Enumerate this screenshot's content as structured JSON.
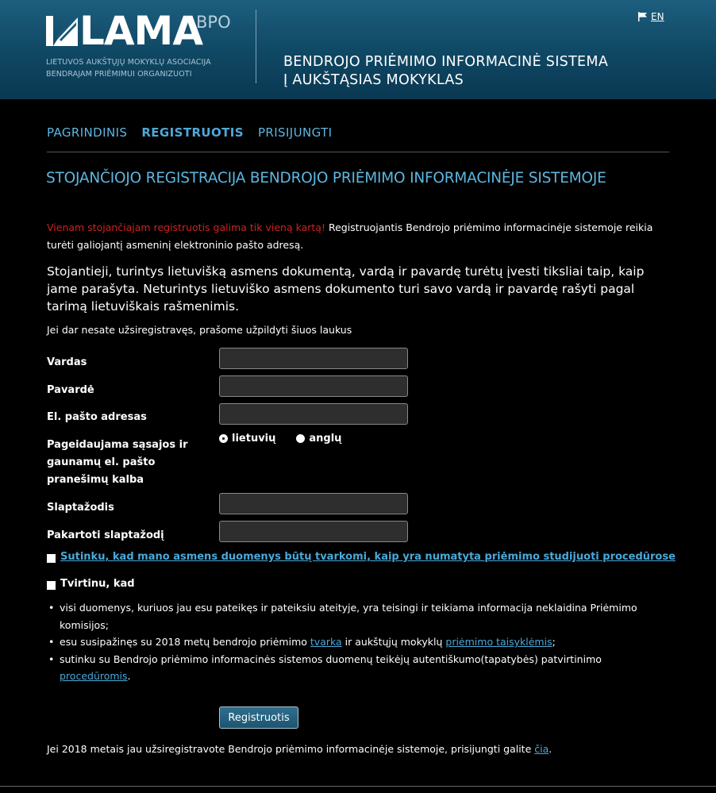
{
  "header": {
    "logo_word": "LAMA",
    "logo_suffix": "BPO",
    "logo_sub_line1": "LIETUVOS AUKŠTŲJŲ MOKYKLŲ ASOCIACIJA",
    "logo_sub_line2": "BENDRAJAM PRIĖMIMUI ORGANIZUOTI",
    "system_title_line1": "BENDROJO PRIĖMIMO INFORMACINĖ SISTEMA",
    "system_title_line2": "Į AUKŠTĄSIAS MOKYKLAS",
    "lang_icon": "flag-icon",
    "lang_label": "EN"
  },
  "nav": {
    "items": [
      {
        "label": "PAGRINDINIS"
      },
      {
        "label": "REGISTRUOTIS"
      },
      {
        "label": "PRISIJUNGTI"
      }
    ]
  },
  "main": {
    "title": "STOJANČIOJO REGISTRACIJA BENDROJO PRIĖMIMO INFORMACINĖJE SISTEMOJE",
    "warning_red": "Vienam stojančiajam registruotis galima tik vieną kartą!",
    "warning_rest": " Registruojantis Bendrojo priėmimo informacinėje sistemoje reikia turėti galiojantį asmeninį elektroninio pašto adresą.",
    "lead": "Stojantieji, turintys lietuvišką asmens dokumentą, vardą ir pavardę turėtų įvesti tiksliai taip, kaip jame parašyta. Neturintys lietuviško asmens dokumento turi savo vardą ir pavardę rašyti pagal tarimą lietuviškais rašmenimis.",
    "prompt": "Jei dar nesate užsiregistravęs, prašome užpildyti šiuos laukus"
  },
  "form": {
    "first_name_label": "Vardas",
    "first_name_value": "",
    "last_name_label": "Pavardė",
    "last_name_value": "",
    "email_label": "El. pašto adresas",
    "email_value": "",
    "language_label": "Pageidaujama sąsajos ir gaunamų el. pašto pranešimų kalba",
    "language_options": [
      "lietuvių",
      "anglų"
    ],
    "language_selected": "lietuvių",
    "password_label": "Slaptažodis",
    "password_repeat_label": "Pakartoti slaptažodį",
    "consent_link": "Sutinku, kad mano asmens duomenys būtų tvarkomi, kaip yra numatyta priėmimo studijuoti procedūrose",
    "affirm_label": "Tvirtinu, kad",
    "bullet1": "visi duomenys, kuriuos jau esu pateikęs ir pateiksiu ateityje, yra teisingi ir teikiama informacija neklaidina Priėmimo komisijos;",
    "bullet2_pre": "esu susipažinęs su 2018 metų bendrojo priėmimo ",
    "bullet2_link1": "tvarka",
    "bullet2_mid": " ir aukštųjų mokyklų ",
    "bullet2_link2": "priėmimo taisyklėmis",
    "bullet2_post": ";",
    "bullet3_pre": "sutinku su Bendrojo priėmimo informacinės sistemos duomenų teikėjų autentiškumo(tapatybės) patvirtinimo ",
    "bullet3_link": "procedūromis",
    "bullet3_post": ".",
    "submit_label": "Registruotis"
  },
  "footer": {
    "text": "Jei 2018 metais jau užsiregistravote Bendrojo priėmimo informacinėje sistemoje, prisijungti galite ",
    "link": "čia",
    "text_end": "."
  },
  "colors": {
    "accent": "#5cb6e0",
    "warning": "#cc2222",
    "header_bg": "#0f4763",
    "page_bg": "#000000"
  }
}
